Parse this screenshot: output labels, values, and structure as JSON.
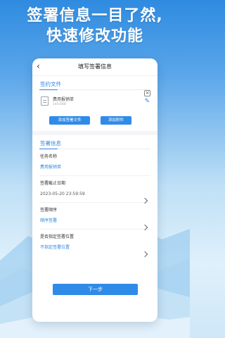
{
  "headline": {
    "line1": "签署信息一目了然,",
    "line2": "快速修改功能"
  },
  "nav": {
    "back_icon": "chevron-left-icon",
    "title": "填写签署信息"
  },
  "contract_section": {
    "title": "签约文件",
    "file": {
      "name": "费用报销单",
      "size": "140.6KB",
      "icon": "document-icon"
    },
    "add_file_button": "添加签署文件",
    "add_attachment_button": "添加附件"
  },
  "sign_info_section": {
    "title": "签署信息",
    "task_name_label": "任务名称",
    "task_name_value": "费用报销单",
    "deadline_label": "签署截止日期",
    "deadline_value": "2023-05-20 23:59:59",
    "order_label": "签署顺序",
    "order_value": "顺序签署",
    "position_label": "是否指定签署位置",
    "position_value": "不指定签署位置"
  },
  "next_button": "下一步",
  "colors": {
    "accent": "#2f86e0",
    "button": "#2f8be8"
  }
}
